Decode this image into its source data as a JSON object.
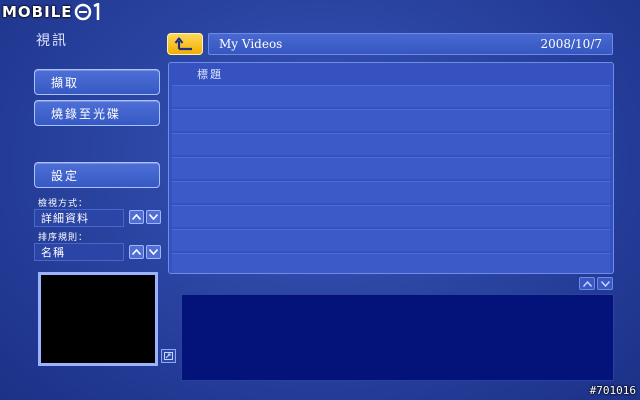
{
  "watermark": {
    "logo_text": "MOBILE",
    "stamp": "#701016"
  },
  "section_title": "視訊",
  "buttons": {
    "capture": "擷取",
    "burn": "燒錄至光碟",
    "settings": "設定"
  },
  "view_mode": {
    "label": "檢視方式：",
    "value": "詳細資料"
  },
  "sort_rule": {
    "label": "排序規則：",
    "value": "名稱"
  },
  "path_bar": {
    "folder": "My Videos",
    "date": "2008/10/7"
  },
  "list": {
    "header": "標題",
    "rows": [
      "",
      "",
      "",
      "",
      "",
      "",
      "",
      "",
      ""
    ]
  },
  "colors": {
    "accent_yellow": "#f0b000",
    "background": "#2a45a2",
    "info_panel": "#03137a"
  },
  "icons": {
    "up": "up-folder-icon",
    "expand": "expand-icon",
    "arrow_up": "chevron-up-icon",
    "arrow_down": "chevron-down-icon"
  }
}
